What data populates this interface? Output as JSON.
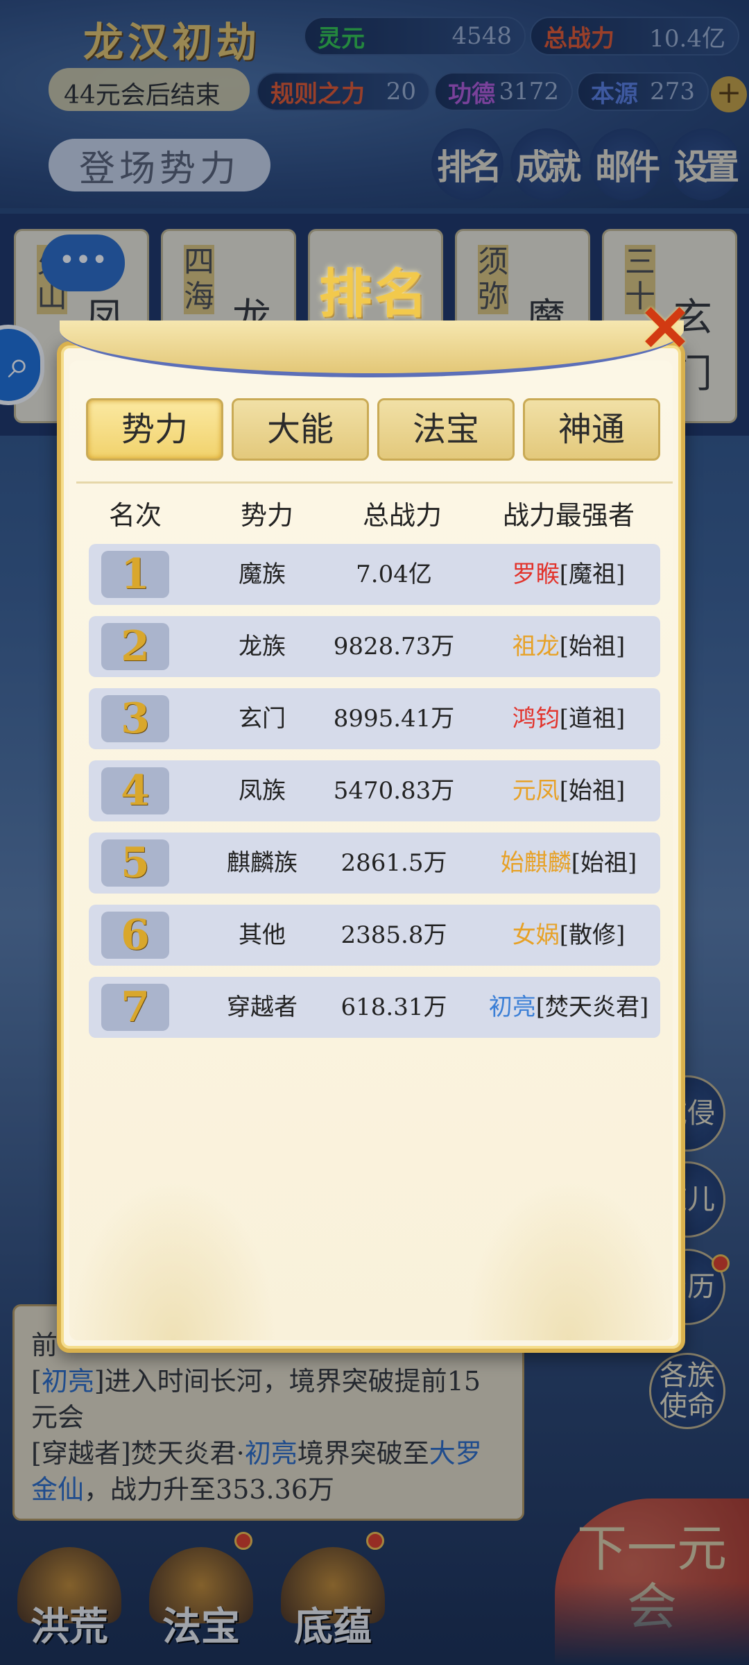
{
  "game": {
    "title": "龙汉初劫",
    "era_end": "44元会后结束",
    "login_btn": "登场势力"
  },
  "stats": [
    {
      "label": "灵元",
      "value": "4548",
      "color": "#34c64a"
    },
    {
      "label": "总战力",
      "value": "10.4亿",
      "color": "#e7562a"
    },
    {
      "label": "规则之力",
      "value": "20",
      "color": "#e7562a"
    },
    {
      "label": "功德",
      "value": "3172",
      "color": "#b55ad8"
    },
    {
      "label": "本源",
      "value": "273",
      "color": "#5b7fe0"
    }
  ],
  "top_buttons": [
    "排名",
    "成就",
    "邮件",
    "设置"
  ],
  "factions_bg": [
    {
      "vtext": "火山",
      "name": "凤"
    },
    {
      "vtext": "四海",
      "name": "龙"
    },
    {
      "vtext": "",
      "name": ""
    },
    {
      "vtext": "须弥",
      "name": "魔"
    },
    {
      "vtext": "三十",
      "name": "玄门"
    }
  ],
  "chat_bubble": "•••",
  "side_buttons": [
    "域侵",
    "道儿",
    "身历",
    "各族使命"
  ],
  "log": {
    "title": "前",
    "lines": [
      {
        "pre": "[",
        "hl": "初亮",
        "post": "]进入时间长河，境界突破提前15元会"
      },
      {
        "pre": "[穿越者]焚天炎君·",
        "hl": "初亮",
        "post": "境界突破至",
        "hl2": "大罗金仙",
        "post2": "，战力升至353.36万"
      }
    ]
  },
  "next_btn": "下一元会",
  "bottom_nav": [
    "洪荒",
    "法宝",
    "底蕴"
  ],
  "modal": {
    "title": "排名",
    "close_icon": "close-x",
    "tabs": [
      "势力",
      "大能",
      "法宝",
      "神通"
    ],
    "active_tab": 0,
    "headers": [
      "名次",
      "势力",
      "总战力",
      "战力最强者"
    ],
    "rows": [
      {
        "rank": "1",
        "faction": "魔族",
        "power": "7.04亿",
        "top_name": "罗睺",
        "top_title": "[魔祖]",
        "name_color": "#e2322a"
      },
      {
        "rank": "2",
        "faction": "龙族",
        "power": "9828.73万",
        "top_name": "祖龙",
        "top_title": "[始祖]",
        "name_color": "#e7a126"
      },
      {
        "rank": "3",
        "faction": "玄门",
        "power": "8995.41万",
        "top_name": "鸿钧",
        "top_title": "[道祖]",
        "name_color": "#e2322a"
      },
      {
        "rank": "4",
        "faction": "凤族",
        "power": "5470.83万",
        "top_name": "元凤",
        "top_title": "[始祖]",
        "name_color": "#e7a126"
      },
      {
        "rank": "5",
        "faction": "麒麟族",
        "power": "2861.5万",
        "top_name": "始麒麟",
        "top_title": "[始祖]",
        "name_color": "#e7a126"
      },
      {
        "rank": "6",
        "faction": "其他",
        "power": "2385.8万",
        "top_name": "女娲",
        "top_title": "[散修]",
        "name_color": "#e7a126"
      },
      {
        "rank": "7",
        "faction": "穿越者",
        "power": "618.31万",
        "top_name": "初亮",
        "top_title": "[焚天炎君]",
        "name_color": "#3b7fd6"
      }
    ]
  }
}
